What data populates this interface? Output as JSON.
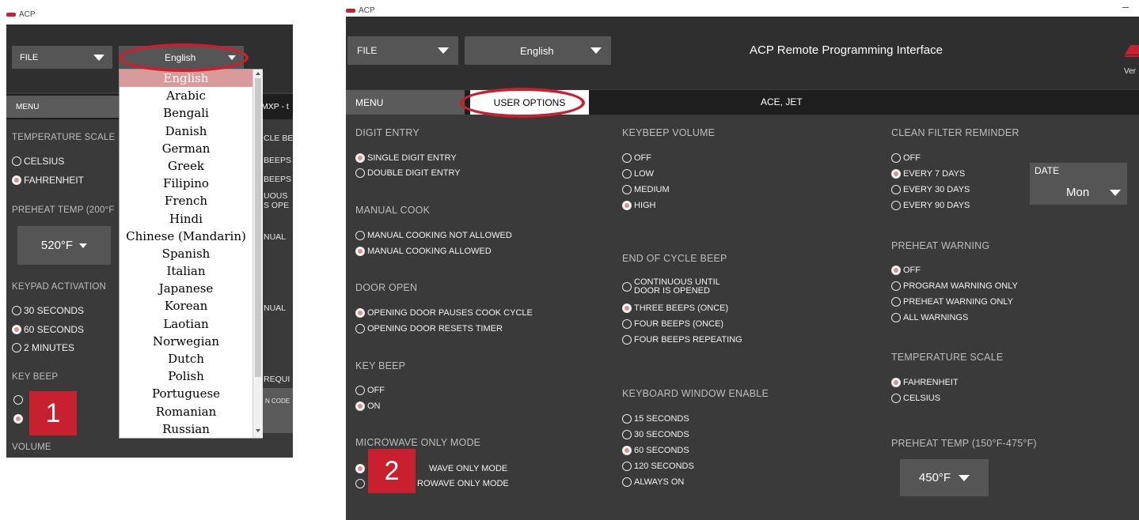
{
  "panel1": {
    "app_title": "ACP",
    "file_dropdown": "FILE",
    "language_dropdown": "English",
    "menu_tab": "MENU",
    "header_partial": "MXP - t",
    "sections": {
      "temperature_scale": "TEMPERATURE SCALE",
      "preheat_temp": "PREHEAT TEMP (200°F",
      "keypad_activation": "KEYPAD ACTIVATION",
      "key_beep": "KEY BEEP",
      "volume": "VOLUME"
    },
    "options": {
      "celsius": "CELSIUS",
      "fahrenheit": "FAHRENHEIT",
      "s30": "30 SECONDS",
      "s60": "60 SECONDS",
      "m2": "2 MINUTES"
    },
    "preheat_value": "520°F",
    "right_partials": [
      "CLE BE",
      "BEEPS",
      "BEEPS",
      "UOUS",
      "S OPE",
      "NUAL",
      "NUAL",
      "REQUI",
      "N CODE"
    ],
    "languages": [
      "English",
      "Arabic",
      "Bengali",
      "Danish",
      "German",
      "Greek",
      "Filipino",
      "French",
      "Hindi",
      "Chinese (Mandarin)",
      "Spanish",
      "Italian",
      "Japanese",
      "Korean",
      "Laotian",
      "Norwegian",
      "Dutch",
      "Polish",
      "Portuguese",
      "Romanian",
      "Russian"
    ],
    "badge": "1"
  },
  "panel2": {
    "app_title": "ACP",
    "file_dropdown": "FILE",
    "language_dropdown": "English",
    "header_title": "ACP Remote Programming Interface",
    "version_partial": "Ver",
    "menu_tab": "MENU",
    "user_options_tab": "USER OPTIONS",
    "models": "ACE, JET",
    "badge": "2",
    "digit_entry": {
      "title": "DIGIT ENTRY",
      "options": [
        "SINGLE DIGIT ENTRY",
        "DOUBLE DIGIT ENTRY"
      ]
    },
    "manual_cook": {
      "title": "MANUAL COOK",
      "options": [
        "MANUAL COOKING NOT ALLOWED",
        "MANUAL COOKING ALLOWED"
      ]
    },
    "door_open": {
      "title": "DOOR OPEN",
      "options": [
        "OPENING DOOR PAUSES COOK CYCLE",
        "OPENING DOOR RESETS TIMER"
      ]
    },
    "key_beep": {
      "title": "KEY BEEP",
      "options": [
        "OFF",
        "ON"
      ]
    },
    "microwave_only": {
      "title": "MICROWAVE ONLY MODE",
      "options": [
        "WAVE ONLY MODE",
        "ROWAVE ONLY MODE"
      ]
    },
    "keybeep_volume": {
      "title": "KEYBEEP VOLUME",
      "options": [
        "OFF",
        "LOW",
        "MEDIUM",
        "HIGH"
      ]
    },
    "end_cycle_beep": {
      "title": "END OF CYCLE BEEP",
      "option1_line1": "CONTINUOUS UNTIL",
      "option1_line2": "DOOR IS OPENED",
      "options": [
        "THREE BEEPS (ONCE)",
        "FOUR BEEPS (ONCE)",
        "FOUR BEEPS REPEATING"
      ]
    },
    "keyboard_window": {
      "title": "KEYBOARD WINDOW ENABLE",
      "options": [
        "15 SECONDS",
        "30 SECONDS",
        "60 SECONDS",
        "120 SECONDS",
        "ALWAYS ON"
      ]
    },
    "clean_filter": {
      "title": "CLEAN FILTER REMINDER",
      "options": [
        "OFF",
        "EVERY 7 DAYS",
        "EVERY 30 DAYS",
        "EVERY 90 DAYS"
      ]
    },
    "date": {
      "label": "DATE",
      "value": "Mon"
    },
    "preheat_warning": {
      "title": "PREHEAT WARNING",
      "options": [
        "OFF",
        "PROGRAM WARNING ONLY",
        "PREHEAT WARNING ONLY",
        "ALL WARNINGS"
      ]
    },
    "temperature_scale": {
      "title": "TEMPERATURE SCALE",
      "options": [
        "FAHRENHEIT",
        "CELSIUS"
      ]
    },
    "preheat_temp": {
      "title": "PREHEAT TEMP (150°F-475°F)",
      "value": "450°F"
    }
  },
  "colors": {
    "accent": "#c8202f",
    "panel": "#3a3a3a",
    "selected_radio": "#e58b8b"
  }
}
